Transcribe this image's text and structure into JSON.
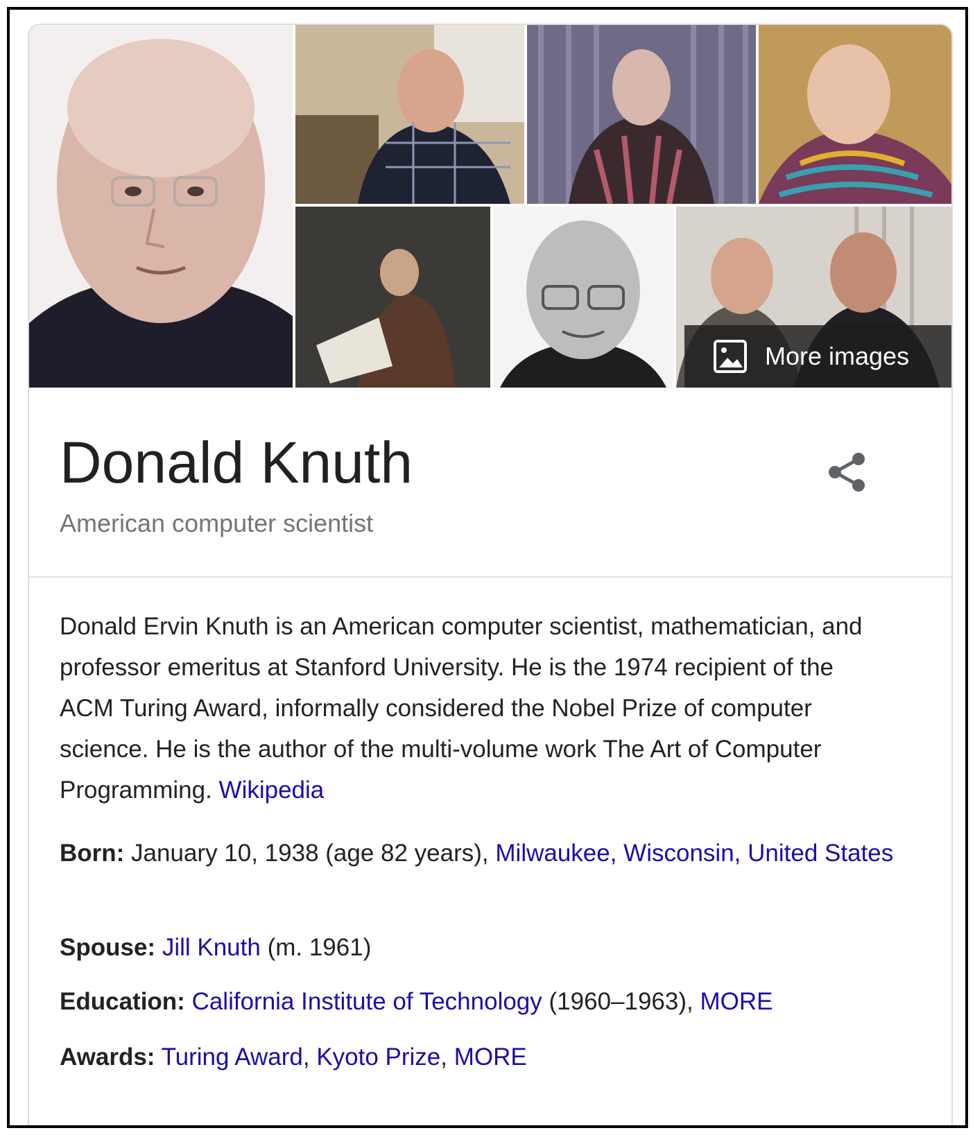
{
  "entity": {
    "name": "Donald Knuth",
    "subtitle": "American computer scientist",
    "description": "Donald Ervin Knuth is an American computer scientist, mathematician, and professor emeritus at Stanford University. He is the 1974 recipient of the ACM Turing Award, informally considered the Nobel Prize of computer science. He is the author of the multi-volume work The Art of Computer Programming.",
    "source_link": "Wikipedia"
  },
  "gallery": {
    "more_images_label": "More images"
  },
  "facts": {
    "born": {
      "label": "Born:",
      "text": "January 10, 1938 (age 82 years),",
      "link": "Milwaukee, Wisconsin, United States"
    },
    "spouse": {
      "label": "Spouse:",
      "link": "Jill Knuth",
      "suffix": "(m. 1961)"
    },
    "education": {
      "label": "Education:",
      "link": "California Institute of Technology",
      "suffix": "(1960–1963),",
      "more": "MORE"
    },
    "awards": {
      "label": "Awards:",
      "link1": "Turing Award",
      "sep1": ",",
      "link2": "Kyoto Prize",
      "sep2": ",",
      "more": "MORE"
    }
  },
  "icons": {
    "share": "share-icon",
    "more_images": "image-icon"
  },
  "colors": {
    "link": "#1a0dab",
    "subtitle": "#70757a",
    "text": "#222222",
    "border": "#dadce0"
  }
}
